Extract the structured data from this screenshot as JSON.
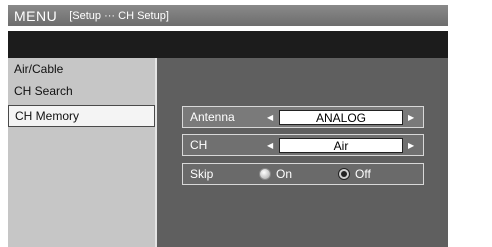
{
  "title": {
    "menu": "MENU",
    "path": "[Setup ··· CH Setup]"
  },
  "sidebar": {
    "items": [
      {
        "label": "Air/Cable"
      },
      {
        "label": "CH Search"
      },
      {
        "label": "CH Memory",
        "selected": true
      }
    ]
  },
  "settings": {
    "antenna": {
      "label": "Antenna",
      "value": "ANALOG"
    },
    "ch": {
      "label": "CH",
      "value": "Air"
    },
    "skip": {
      "label": "Skip",
      "option_on": "On",
      "option_off": "Off",
      "selected": "Off"
    }
  },
  "colors": {
    "title_bar": "#7a7a7a",
    "screen_bg": "#5f5f5f",
    "sidebar_bg": "#c6c6c6",
    "top_band": "#1c1c1c"
  }
}
